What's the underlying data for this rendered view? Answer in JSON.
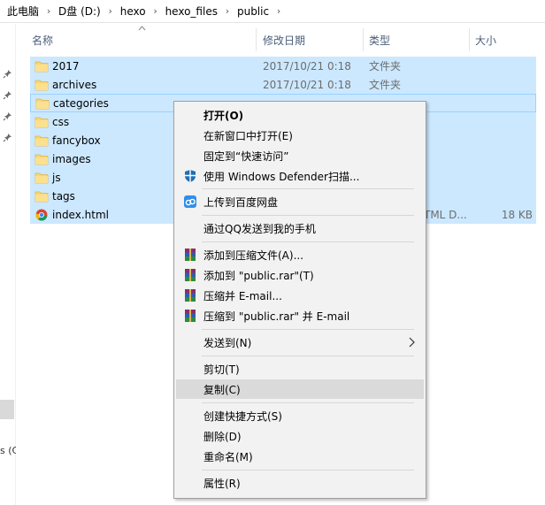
{
  "breadcrumb": [
    "此电脑",
    "D盘 (D:)",
    "hexo",
    "hexo_files",
    "public"
  ],
  "columns": {
    "name": "名称",
    "modified": "修改日期",
    "type": "类型",
    "size": "大小"
  },
  "files": [
    {
      "name": "2017",
      "date": "2017/10/21 0:18",
      "type": "文件夹",
      "size": "",
      "icon": "folder-icon"
    },
    {
      "name": "archives",
      "date": "2017/10/21 0:18",
      "type": "文件夹",
      "size": "",
      "icon": "folder-icon"
    },
    {
      "name": "categories",
      "date": "",
      "type": "",
      "size": "",
      "icon": "folder-icon"
    },
    {
      "name": "css",
      "date": "",
      "type": "",
      "size": "",
      "icon": "folder-icon"
    },
    {
      "name": "fancybox",
      "date": "",
      "type": "",
      "size": "",
      "icon": "folder-icon"
    },
    {
      "name": "images",
      "date": "",
      "type": "",
      "size": "",
      "icon": "folder-icon"
    },
    {
      "name": "js",
      "date": "",
      "type": "",
      "size": "",
      "icon": "folder-icon"
    },
    {
      "name": "tags",
      "date": "",
      "type": "",
      "size": "",
      "icon": "folder-icon"
    },
    {
      "name": "index.html",
      "date": "",
      "type": "TML D...",
      "size": "18 KB",
      "icon": "chrome-html-icon"
    }
  ],
  "nav_fragment": "s (C",
  "context_menu": {
    "open": "打开(O)",
    "open_new_window": "在新窗口中打开(E)",
    "pin_quick_access": "固定到“快速访问”",
    "defender_scan": "使用 Windows Defender扫描...",
    "upload_baidu": "上传到百度网盘",
    "send_qq_phone": "通过QQ发送到我的手机",
    "add_archive": "添加到压缩文件(A)...",
    "add_public_rar": "添加到 \"public.rar\"(T)",
    "compress_email": "压缩并 E-mail...",
    "compress_public_rar_email": "压缩到 \"public.rar\" 并 E-mail",
    "send_to": "发送到(N)",
    "cut": "剪切(T)",
    "copy": "复制(C)",
    "create_shortcut": "创建快捷方式(S)",
    "delete": "删除(D)",
    "rename": "重命名(M)",
    "properties": "属性(R)"
  },
  "colors": {
    "selection": "#cce8ff",
    "selection_border": "#99d1ff",
    "folder": "#f8d775",
    "menu_bg": "#f2f2f2",
    "menu_hover": "#dadada",
    "header_text": "#4c607a"
  }
}
